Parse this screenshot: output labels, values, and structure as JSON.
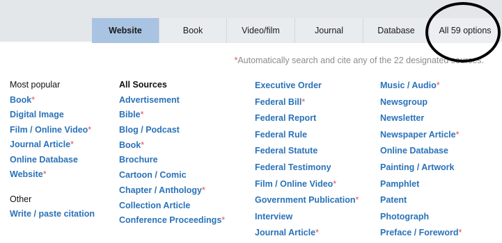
{
  "tabs": [
    {
      "label": "Website",
      "active": true
    },
    {
      "label": "Book",
      "active": false
    },
    {
      "label": "Video/film",
      "active": false
    },
    {
      "label": "Journal",
      "active": false
    },
    {
      "label": "Database",
      "active": false
    },
    {
      "label": "All 59 options",
      "active": false
    }
  ],
  "notice": {
    "prefix": "*",
    "text": "Automatically search and cite any of the 22 designated sources."
  },
  "most_popular": {
    "heading": "Most popular",
    "items": [
      {
        "label": "Book",
        "star": "*"
      },
      {
        "label": "Digital Image",
        "star": ""
      },
      {
        "label": "Film / Online Video",
        "star": "*"
      },
      {
        "label": "Journal Article",
        "star": "*"
      },
      {
        "label": "Online Database",
        "star": ""
      },
      {
        "label": "Website",
        "star": "*"
      }
    ]
  },
  "other": {
    "heading": "Other",
    "items": [
      {
        "label": "Write / paste citation",
        "star": ""
      }
    ]
  },
  "all_sources": {
    "heading": "All Sources",
    "col1": [
      {
        "label": "Advertisement",
        "star": ""
      },
      {
        "label": "Bible",
        "star": "*"
      },
      {
        "label": "Blog / Podcast",
        "star": ""
      },
      {
        "label": "Book",
        "star": "*"
      },
      {
        "label": "Brochure",
        "star": ""
      },
      {
        "label": "Cartoon / Comic",
        "star": ""
      },
      {
        "label": "Chapter / Anthology",
        "star": "*"
      },
      {
        "label": "Collection Article",
        "star": ""
      },
      {
        "label": "Conference Proceedings",
        "star": "*"
      }
    ],
    "col2": [
      {
        "label": "Executive Order",
        "star": ""
      },
      {
        "label": "Federal Bill",
        "star": "*"
      },
      {
        "label": "Federal Report",
        "star": ""
      },
      {
        "label": "Federal Rule",
        "star": ""
      },
      {
        "label": "Federal Statute",
        "star": ""
      },
      {
        "label": "Federal Testimony",
        "star": ""
      },
      {
        "label": "Film / Online Video",
        "star": "*"
      },
      {
        "label": "Government Publication",
        "star": "*"
      },
      {
        "label": "Interview",
        "star": ""
      },
      {
        "label": "Journal Article",
        "star": "*"
      }
    ],
    "col3": [
      {
        "label": "Music / Audio",
        "star": "*"
      },
      {
        "label": "Newsgroup",
        "star": ""
      },
      {
        "label": "Newsletter",
        "star": ""
      },
      {
        "label": "Newspaper Article",
        "star": "*"
      },
      {
        "label": "Online Database",
        "star": ""
      },
      {
        "label": "Painting / Artwork",
        "star": ""
      },
      {
        "label": "Pamphlet",
        "star": ""
      },
      {
        "label": "Patent",
        "star": ""
      },
      {
        "label": "Photograph",
        "star": ""
      },
      {
        "label": "Preface / Foreword",
        "star": "*"
      }
    ]
  },
  "colors": {
    "link": "#2a72b8",
    "star": "#e0524f",
    "active_tab": "#a9c3e2",
    "band": "#e4e7ea"
  }
}
